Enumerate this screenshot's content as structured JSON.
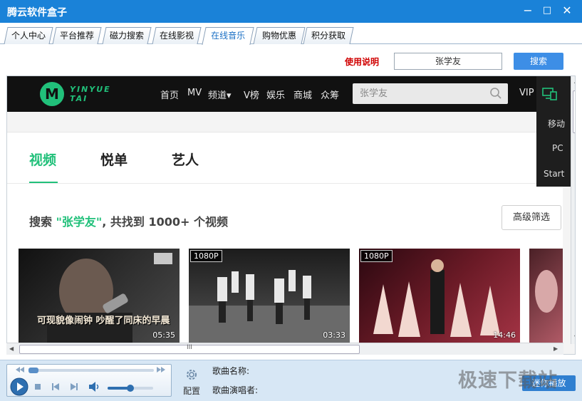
{
  "window": {
    "title": "腾云软件盒子",
    "minimize_symbol": "−",
    "maximize_symbol": "□",
    "close_symbol": "✕"
  },
  "tabs": [
    {
      "label": "个人中心",
      "active": false
    },
    {
      "label": "平台推荐",
      "active": false
    },
    {
      "label": "磁力搜索",
      "active": false
    },
    {
      "label": "在线影视",
      "active": false
    },
    {
      "label": "在线音乐",
      "active": true
    },
    {
      "label": "购物优惠",
      "active": false
    },
    {
      "label": "积分获取",
      "active": false
    }
  ],
  "search_row": {
    "help_label": "使用说明",
    "query": "张学友",
    "button_label": "搜索"
  },
  "site": {
    "logo_letter": "M",
    "logo_line1": "YINYUE",
    "logo_line2": "TAI",
    "nav": [
      "首页",
      "MV",
      "频道▾",
      "V榜",
      "娱乐",
      "商城",
      "众筹"
    ],
    "search_value": "张学友",
    "vip_label": "VIP",
    "side_panel": [
      "移动",
      "PC",
      "Start"
    ],
    "content_tabs": [
      {
        "label": "视频",
        "active": true
      },
      {
        "label": "悦单",
        "active": false
      },
      {
        "label": "艺人",
        "active": false
      }
    ],
    "result": {
      "prefix": "搜索 ",
      "keyword": "\"张学友\"",
      "suffix": ", 共找到 1000+ 个视频"
    },
    "advanced_filter_label": "高级筛选",
    "videos": [
      {
        "badge": "",
        "duration": "05:35",
        "caption": "可现貌像闹钟  吵醒了同床的早晨",
        "colors": [
          "#1a1a1a",
          "#3a3a3a"
        ]
      },
      {
        "badge": "1080P",
        "duration": "03:33",
        "caption": "",
        "colors": [
          "#2a2a2a",
          "#5a5a5a"
        ]
      },
      {
        "badge": "1080P",
        "duration": "14:46",
        "caption": "",
        "colors": [
          "#3b0f16",
          "#a63a48"
        ]
      },
      {
        "badge": "",
        "duration": "",
        "caption": "",
        "colors": [
          "#5a2a30",
          "#c06a74"
        ]
      }
    ]
  },
  "player": {
    "config_label": "配置",
    "song_name_label": "歌曲名称:",
    "song_singer_label": "歌曲演唱者:",
    "volume_fraction": 0.5,
    "progress_fraction": 0.0,
    "mini_button_label": "迷你播放"
  },
  "watermark": "极速下载站",
  "scroll_grip": "III"
}
